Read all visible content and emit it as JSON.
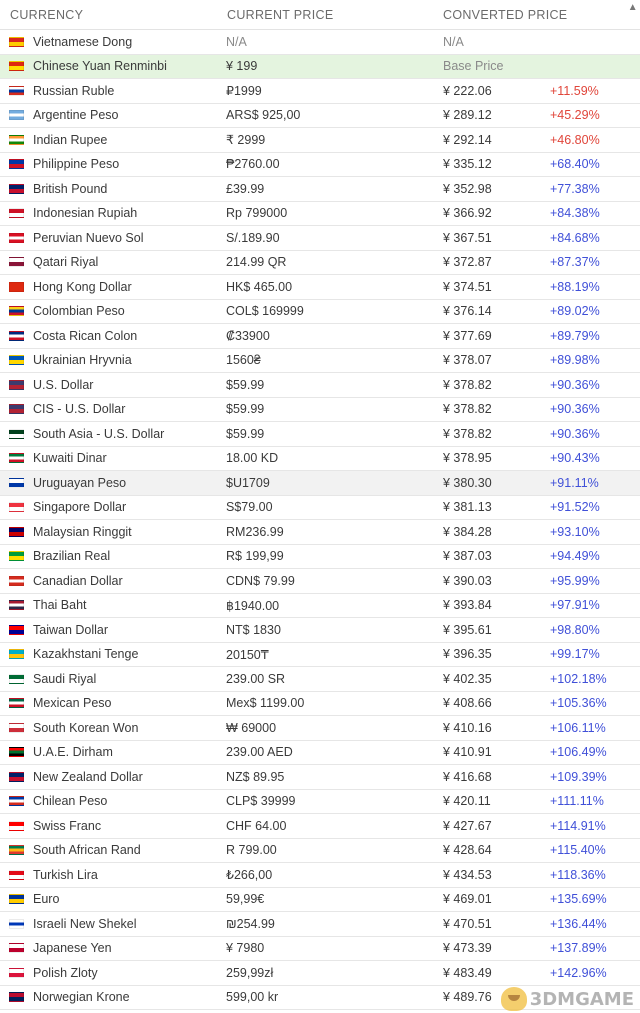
{
  "header": {
    "currency": "CURRENCY",
    "current_price": "CURRENT PRICE",
    "converted_price": "CONVERTED PRICE",
    "sort_icon": "▲"
  },
  "watermark": "3DMGAME",
  "rows": [
    {
      "name": "Vietnamese Dong",
      "price": "N/A",
      "converted": "N/A",
      "pct": "",
      "flag": [
        "#da251d",
        "#ffcd00"
      ],
      "style": "na"
    },
    {
      "name": "Chinese Yuan Renminbi",
      "price": "¥ 199",
      "converted": "Base Price",
      "pct": "",
      "flag": [
        "#de2910",
        "#ffde00"
      ],
      "style": "base"
    },
    {
      "name": "Russian Ruble",
      "price": "₽1999",
      "converted": "¥ 222.06",
      "pct": "+11.59%",
      "flag": [
        "#ffffff",
        "#0039a6",
        "#d52b1e"
      ],
      "pctColor": "red"
    },
    {
      "name": "Argentine Peso",
      "price": "ARS$ 925,00",
      "converted": "¥ 289.12",
      "pct": "+45.29%",
      "flag": [
        "#74acdf",
        "#ffffff",
        "#74acdf"
      ],
      "pctColor": "red"
    },
    {
      "name": "Indian Rupee",
      "price": "₹ 2999",
      "converted": "¥ 292.14",
      "pct": "+46.80%",
      "flag": [
        "#ff9933",
        "#ffffff",
        "#138808"
      ],
      "pctColor": "red"
    },
    {
      "name": "Philippine Peso",
      "price": "₱2760.00",
      "converted": "¥ 335.12",
      "pct": "+68.40%",
      "flag": [
        "#0038a8",
        "#ce1126"
      ],
      "pctColor": "blue"
    },
    {
      "name": "British Pound",
      "price": "£39.99",
      "converted": "¥ 352.98",
      "pct": "+77.38%",
      "flag": [
        "#012169",
        "#c8102e"
      ],
      "pctColor": "blue"
    },
    {
      "name": "Indonesian Rupiah",
      "price": "Rp 799000",
      "converted": "¥ 366.92",
      "pct": "+84.38%",
      "flag": [
        "#ce1126",
        "#ffffff"
      ],
      "pctColor": "blue"
    },
    {
      "name": "Peruvian Nuevo Sol",
      "price": "S/.189.90",
      "converted": "¥ 367.51",
      "pct": "+84.68%",
      "flag": [
        "#d91023",
        "#ffffff",
        "#d91023"
      ],
      "pctColor": "blue"
    },
    {
      "name": "Qatari Riyal",
      "price": "214.99 QR",
      "converted": "¥ 372.87",
      "pct": "+87.37%",
      "flag": [
        "#ffffff",
        "#8a1538"
      ],
      "pctColor": "blue"
    },
    {
      "name": "Hong Kong Dollar",
      "price": "HK$ 465.00",
      "converted": "¥ 374.51",
      "pct": "+88.19%",
      "flag": [
        "#de2910",
        "#de2910"
      ],
      "pctColor": "blue"
    },
    {
      "name": "Colombian Peso",
      "price": "COL$ 169999",
      "converted": "¥ 376.14",
      "pct": "+89.02%",
      "flag": [
        "#fcd116",
        "#003893",
        "#ce1126"
      ],
      "pctColor": "blue"
    },
    {
      "name": "Costa Rican Colon",
      "price": "₡33900",
      "converted": "¥ 377.69",
      "pct": "+89.79%",
      "flag": [
        "#002b7f",
        "#ffffff",
        "#ce1126"
      ],
      "pctColor": "blue"
    },
    {
      "name": "Ukrainian Hryvnia",
      "price": "1560₴",
      "converted": "¥ 378.07",
      "pct": "+89.98%",
      "flag": [
        "#0057b7",
        "#ffd700"
      ],
      "pctColor": "blue"
    },
    {
      "name": "U.S. Dollar",
      "price": "$59.99",
      "converted": "¥ 378.82",
      "pct": "+90.36%",
      "flag": [
        "#3c3b6e",
        "#b22234"
      ],
      "pctColor": "blue"
    },
    {
      "name": "CIS - U.S. Dollar",
      "price": "$59.99",
      "converted": "¥ 378.82",
      "pct": "+90.36%",
      "flag": [
        "#3c3b6e",
        "#b22234"
      ],
      "pctColor": "blue"
    },
    {
      "name": "South Asia - U.S. Dollar",
      "price": "$59.99",
      "converted": "¥ 378.82",
      "pct": "+90.36%",
      "flag": [
        "#01411c",
        "#ffffff"
      ],
      "pctColor": "blue"
    },
    {
      "name": "Kuwaiti Dinar",
      "price": "18.00 KD",
      "converted": "¥ 378.95",
      "pct": "+90.43%",
      "flag": [
        "#007a3d",
        "#ffffff",
        "#ce1126"
      ],
      "pctColor": "blue"
    },
    {
      "name": "Uruguayan Peso",
      "price": "$U1709",
      "converted": "¥ 380.30",
      "pct": "+91.11%",
      "flag": [
        "#ffffff",
        "#0038a8"
      ],
      "pctColor": "blue",
      "hover": true
    },
    {
      "name": "Singapore Dollar",
      "price": "S$79.00",
      "converted": "¥ 381.13",
      "pct": "+91.52%",
      "flag": [
        "#ef3340",
        "#ffffff"
      ],
      "pctColor": "blue"
    },
    {
      "name": "Malaysian Ringgit",
      "price": "RM236.99",
      "converted": "¥ 384.28",
      "pct": "+93.10%",
      "flag": [
        "#010066",
        "#cc0001"
      ],
      "pctColor": "blue"
    },
    {
      "name": "Brazilian Real",
      "price": "R$ 199,99",
      "converted": "¥ 387.03",
      "pct": "+94.49%",
      "flag": [
        "#009c3b",
        "#ffdf00"
      ],
      "pctColor": "blue"
    },
    {
      "name": "Canadian Dollar",
      "price": "CDN$ 79.99",
      "converted": "¥ 390.03",
      "pct": "+95.99%",
      "flag": [
        "#d52b1e",
        "#ffffff",
        "#d52b1e"
      ],
      "pctColor": "blue"
    },
    {
      "name": "Thai Baht",
      "price": "฿1940.00",
      "converted": "¥ 393.84",
      "pct": "+97.91%",
      "flag": [
        "#a51931",
        "#ffffff",
        "#2d2a4a"
      ],
      "pctColor": "blue"
    },
    {
      "name": "Taiwan Dollar",
      "price": "NT$ 1830",
      "converted": "¥ 395.61",
      "pct": "+98.80%",
      "flag": [
        "#fe0000",
        "#000095"
      ],
      "pctColor": "blue"
    },
    {
      "name": "Kazakhstani Tenge",
      "price": "20150₸",
      "converted": "¥ 396.35",
      "pct": "+99.17%",
      "flag": [
        "#00afca",
        "#fec50c"
      ],
      "pctColor": "blue"
    },
    {
      "name": "Saudi Riyal",
      "price": "239.00 SR",
      "converted": "¥ 402.35",
      "pct": "+102.18%",
      "flag": [
        "#006c35",
        "#ffffff"
      ],
      "pctColor": "blue"
    },
    {
      "name": "Mexican Peso",
      "price": "Mex$ 1199.00",
      "converted": "¥ 408.66",
      "pct": "+105.36%",
      "flag": [
        "#006847",
        "#ffffff",
        "#ce1126"
      ],
      "pctColor": "blue"
    },
    {
      "name": "South Korean Won",
      "price": "₩ 69000",
      "converted": "¥ 410.16",
      "pct": "+106.11%",
      "flag": [
        "#ffffff",
        "#cd2e3a"
      ],
      "pctColor": "blue"
    },
    {
      "name": "U.A.E. Dirham",
      "price": "239.00 AED",
      "converted": "¥ 410.91",
      "pct": "+106.49%",
      "flag": [
        "#ff0000",
        "#00732f",
        "#000000"
      ],
      "pctColor": "blue"
    },
    {
      "name": "New Zealand Dollar",
      "price": "NZ$ 89.95",
      "converted": "¥ 416.68",
      "pct": "+109.39%",
      "flag": [
        "#012169",
        "#c8102e"
      ],
      "pctColor": "blue"
    },
    {
      "name": "Chilean Peso",
      "price": "CLP$ 39999",
      "converted": "¥ 420.11",
      "pct": "+111.11%",
      "flag": [
        "#0039a6",
        "#ffffff",
        "#d52b1e"
      ],
      "pctColor": "blue"
    },
    {
      "name": "Swiss Franc",
      "price": "CHF 64.00",
      "converted": "¥ 427.67",
      "pct": "+114.91%",
      "flag": [
        "#ff0000",
        "#ffffff"
      ],
      "pctColor": "blue"
    },
    {
      "name": "South African Rand",
      "price": "R 799.00",
      "converted": "¥ 428.64",
      "pct": "+115.40%",
      "flag": [
        "#007a4d",
        "#ffb612",
        "#de3831"
      ],
      "pctColor": "blue"
    },
    {
      "name": "Turkish Lira",
      "price": "₺266,00",
      "converted": "¥ 434.53",
      "pct": "+118.36%",
      "flag": [
        "#e30a17",
        "#ffffff"
      ],
      "pctColor": "blue"
    },
    {
      "name": "Euro",
      "price": "59,99€",
      "converted": "¥ 469.01",
      "pct": "+135.69%",
      "flag": [
        "#003399",
        "#ffcc00"
      ],
      "pctColor": "blue"
    },
    {
      "name": "Israeli New Shekel",
      "price": "₪254.99",
      "converted": "¥ 470.51",
      "pct": "+136.44%",
      "flag": [
        "#ffffff",
        "#0038b8",
        "#ffffff"
      ],
      "pctColor": "blue"
    },
    {
      "name": "Japanese Yen",
      "price": "¥ 7980",
      "converted": "¥ 473.39",
      "pct": "+137.89%",
      "flag": [
        "#ffffff",
        "#bc002d"
      ],
      "pctColor": "blue"
    },
    {
      "name": "Polish Zloty",
      "price": "259,99zł",
      "converted": "¥ 483.49",
      "pct": "+142.96%",
      "flag": [
        "#ffffff",
        "#dc143c"
      ],
      "pctColor": "blue"
    },
    {
      "name": "Norwegian Krone",
      "price": "599,00 kr",
      "converted": "¥ 489.76",
      "pct": "",
      "flag": [
        "#ba0c2f",
        "#00205b"
      ],
      "pctColor": "blue"
    }
  ]
}
